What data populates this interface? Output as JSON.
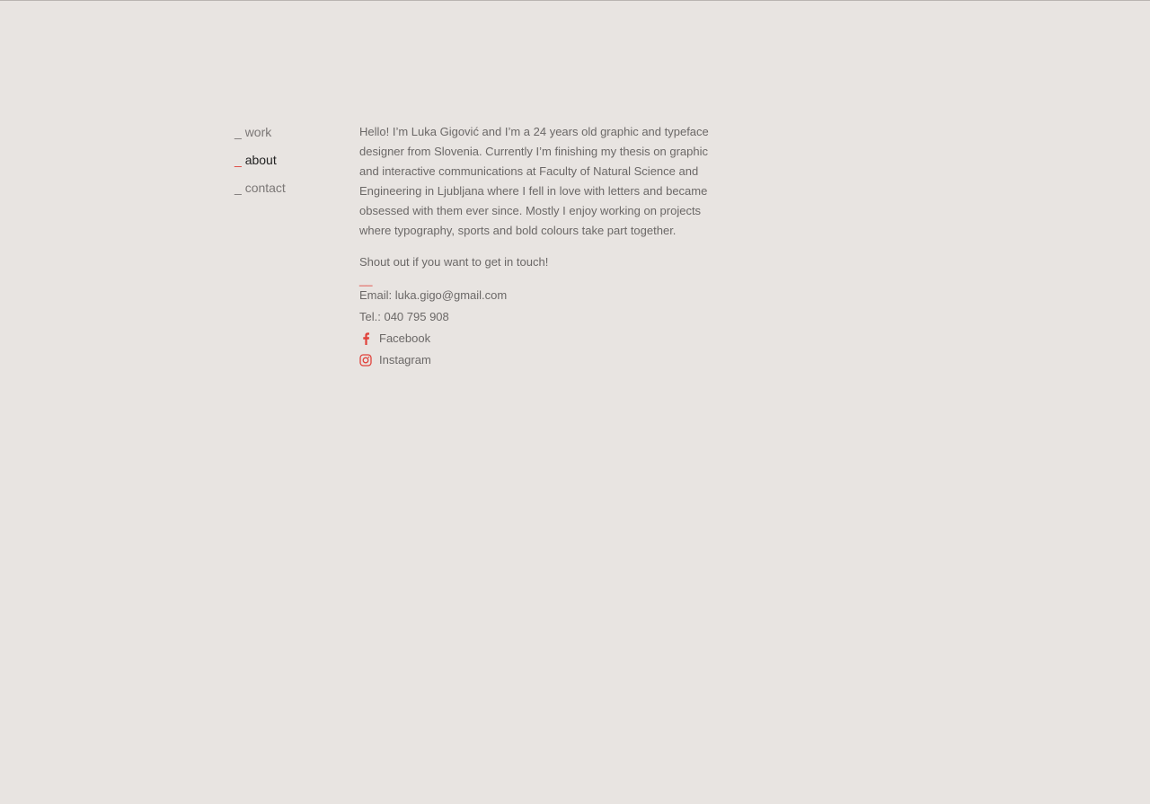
{
  "nav": {
    "items": [
      {
        "mark": "_",
        "label": "work"
      },
      {
        "mark": "_",
        "label": "about"
      },
      {
        "mark": "_",
        "label": "contact"
      }
    ],
    "active_index": 1
  },
  "about": {
    "bio": "Hello! I’m Luka Gigović and I’m a 24 years old graphic and typeface designer from Slovenia. Currently I’m finishing my thesis on graphic and interactive communications at Faculty of Natural Science and Engineering in Ljubljana where I fell in love with letters and became obsessed with them ever since. Mostly I enjoy working on projects where typography, sports and bold colours take part together.",
    "shout": "Shout out if you want to get in touch!",
    "divider": "__",
    "email_label": "Email: ",
    "email": "luka.gigo@gmail.com",
    "tel_label": "Tel.: ",
    "tel": "040 795 908",
    "facebook_label": "Facebook",
    "instagram_label": "Instagram"
  },
  "colors": {
    "background": "#e8e4e1",
    "accent": "#e0423b",
    "text": "#6b6867",
    "active_text": "#222222"
  },
  "icons": {
    "facebook": "facebook-icon",
    "instagram": "instagram-icon"
  }
}
